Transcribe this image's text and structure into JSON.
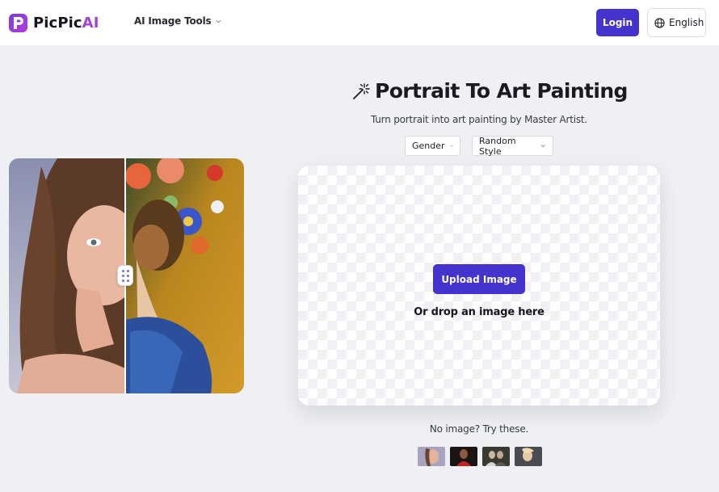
{
  "header": {
    "logo_prefix": "PicPic",
    "logo_suffix": "AI",
    "tools_menu_label": "AI Image Tools",
    "login_label": "Login",
    "language_label": "English"
  },
  "hero": {
    "title": "Portrait To Art Painting",
    "subtitle": "Turn portrait into art painting by Master Artist.",
    "gender_select": "Gender",
    "style_select": "Random Style"
  },
  "upload": {
    "button_label": "Upload Image",
    "drop_text": "Or drop an image here"
  },
  "samples": {
    "label": "No image? Try these.",
    "thumbnails": [
      "sample-portrait-1",
      "sample-portrait-2",
      "sample-portrait-3",
      "sample-portrait-4"
    ]
  },
  "colors": {
    "accent": "#4433cc",
    "brand_gradient_start": "#7b3be0",
    "brand_ai": "#a542d8",
    "page_bg": "#eef0f4"
  }
}
